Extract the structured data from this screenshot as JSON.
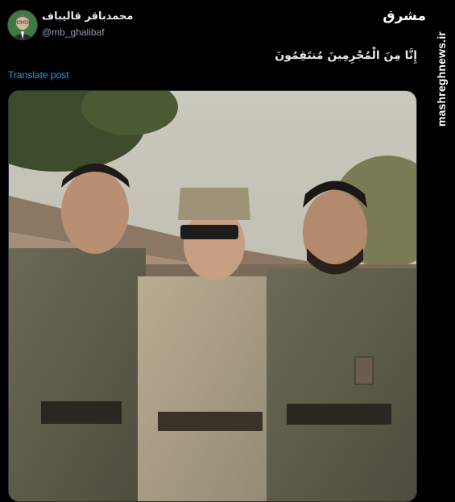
{
  "post": {
    "display_name": "محمدباقر قالیباف",
    "handle": "@mb_ghalibaf",
    "text": "إِنَّا مِنَ الْمُجْرِمِينَ مُنتَقِمُونَ",
    "translate_label": "Translate post"
  },
  "watermark": {
    "site": "mashreghnews.ir",
    "logo_text": "مشرق"
  },
  "media": {
    "description_icon": "photo-icon"
  },
  "colors": {
    "background": "#000000",
    "primary_text": "#e7e9ea",
    "secondary_text": "#8b98a5",
    "link": "#1d9bf0"
  }
}
